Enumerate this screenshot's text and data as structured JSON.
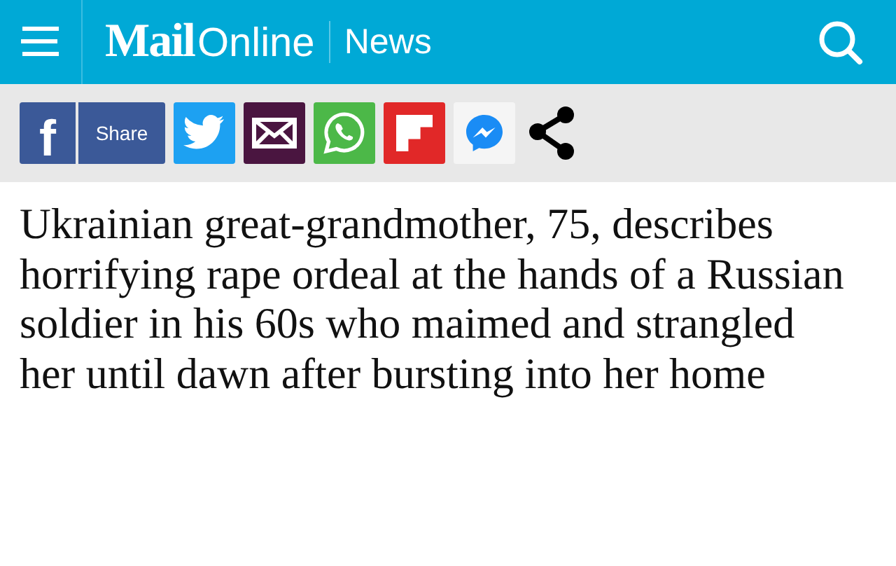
{
  "header": {
    "brand_bold": "Mail",
    "brand_light": "Online",
    "section": "News"
  },
  "share_bar": {
    "facebook_letter": "f",
    "share_label": "Share"
  },
  "headline": "Ukrainian great-grandmother, 75, describes horrifying rape ordeal at the hands of a Russian soldier in his 60s who maimed and strangled her until dawn after bursting into her home"
}
